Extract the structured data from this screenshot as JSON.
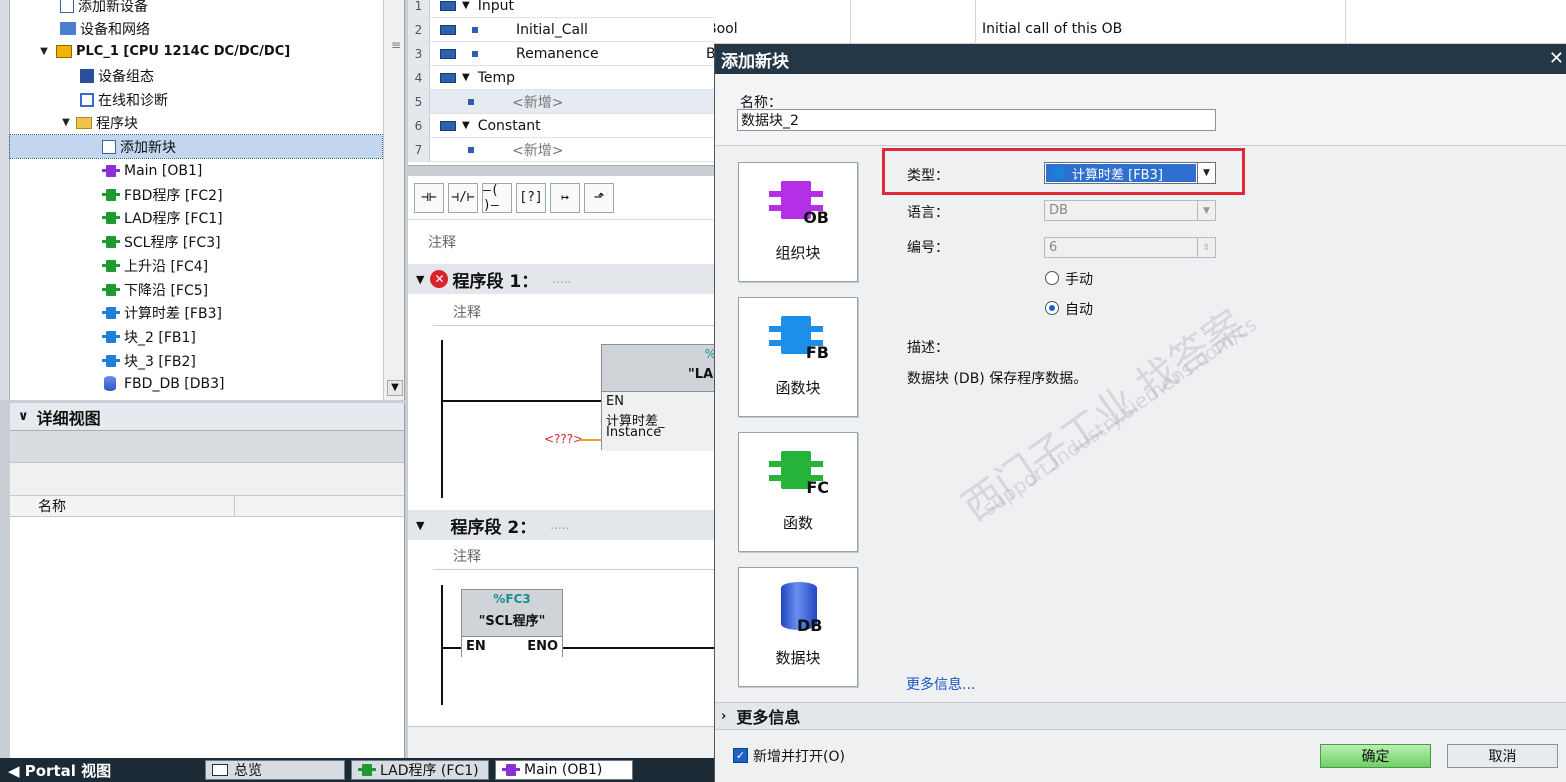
{
  "tree": {
    "items": [
      {
        "label": "添加新设备",
        "indent": 1
      },
      {
        "label": "设备和网络",
        "indent": 1
      },
      {
        "label": "PLC_1 [CPU 1214C DC/DC/DC]",
        "indent": 1
      },
      {
        "label": "设备组态",
        "indent": 2
      },
      {
        "label": "在线和诊断",
        "indent": 2
      },
      {
        "label": "程序块",
        "indent": 2
      },
      {
        "label": "添加新块",
        "indent": 3
      },
      {
        "label": "Main [OB1]",
        "indent": 3
      },
      {
        "label": "FBD程序 [FC2]",
        "indent": 3
      },
      {
        "label": "LAD程序 [FC1]",
        "indent": 3
      },
      {
        "label": "SCL程序 [FC3]",
        "indent": 3
      },
      {
        "label": "上升沿 [FC4]",
        "indent": 3
      },
      {
        "label": "下降沿 [FC5]",
        "indent": 3
      },
      {
        "label": "计算时差 [FB3]",
        "indent": 3
      },
      {
        "label": "块_2 [FB1]",
        "indent": 3
      },
      {
        "label": "块_3 [FB2]",
        "indent": 3
      },
      {
        "label": "FBD_DB [DB3]",
        "indent": 3
      }
    ]
  },
  "details": {
    "title": "详细视图",
    "col_name": "名称"
  },
  "statusbar": {
    "portal": "◀  Portal 视图",
    "tabs": [
      "总览",
      "LAD程序 (FC1)",
      "Main (OB1)"
    ]
  },
  "iface": {
    "rows": [
      {
        "num": "1",
        "name": "Input"
      },
      {
        "num": "2",
        "name": "Initial_Call"
      },
      {
        "num": "3",
        "name": "Remanence"
      },
      {
        "num": "4",
        "name": "Temp"
      },
      {
        "num": "5",
        "name": "<新增>"
      },
      {
        "num": "6",
        "name": "Constant"
      },
      {
        "num": "7",
        "name": "<新增>"
      }
    ],
    "datatype": "Bool",
    "datatype_clip": "B",
    "comment": "Initial call of this OB"
  },
  "editor": {
    "comment": "注释",
    "seg1": "程序段 1：",
    "seg1_dots": ".....",
    "seg2": "程序段 2：",
    "seg2_dots": ".....",
    "block1_title": "%",
    "block1_name": "\"LAI",
    "block1_en": "EN",
    "block1_inst": "计算时差_",
    "block1_inst2": "Instance",
    "param_unknown": "<???>",
    "block2_addr": "%FC3",
    "block2_name": "\"SCL程序\"",
    "block2_en": "EN",
    "block2_eno": "ENO"
  },
  "dialog": {
    "title": "添加新块",
    "close": "✕",
    "name_label": "名称：",
    "name_value": "数据块_2",
    "types": [
      {
        "label": "组织块",
        "tag": "OB",
        "color": "#b430e6"
      },
      {
        "label": "函数块",
        "tag": "FB",
        "color": "#1e8fe8"
      },
      {
        "label": "函数",
        "tag": "FC",
        "color": "#25b33a"
      },
      {
        "label": "数据块",
        "tag": "DB",
        "color": "#2d57c8"
      }
    ],
    "type_label": "类型：",
    "type_value": "计算时差 [FB3]",
    "lang_label": "语言：",
    "lang_value": "DB",
    "num_label": "编号：",
    "num_value": "6",
    "manual": "手动",
    "auto": "自动",
    "desc_label": "描述：",
    "desc_value": "数据块 (DB) 保存程序数据。",
    "more_link": "更多信息...",
    "more_bar": "更多信息",
    "add_open": "新增并打开(O)",
    "ok": "确定",
    "cancel": "取消",
    "watermark1": "西门子工业 找答案",
    "watermark2": "support.industry.siemens.com/cs"
  }
}
